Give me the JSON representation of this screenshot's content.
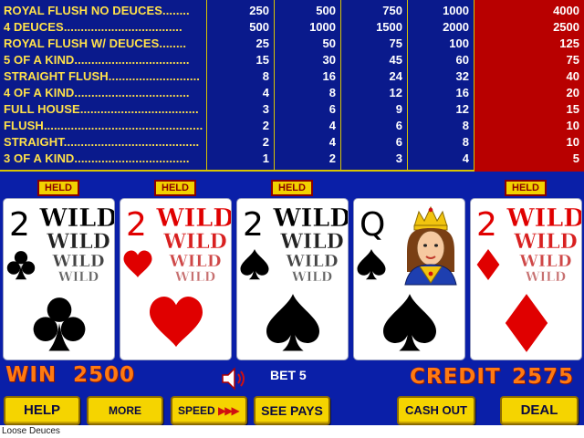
{
  "paytable": {
    "rows": [
      {
        "name": "ROYAL FLUSH NO DEUCES........",
        "pays": [
          "250",
          "500",
          "750",
          "1000",
          "4000"
        ]
      },
      {
        "name": "4 DEUCES...................................",
        "pays": [
          "500",
          "1000",
          "1500",
          "2000",
          "2500"
        ]
      },
      {
        "name": "ROYAL FLUSH W/ DEUCES........",
        "pays": [
          "25",
          "50",
          "75",
          "100",
          "125"
        ]
      },
      {
        "name": "5 OF A KIND..................................",
        "pays": [
          "15",
          "30",
          "45",
          "60",
          "75"
        ]
      },
      {
        "name": "STRAIGHT FLUSH...........................",
        "pays": [
          "8",
          "16",
          "24",
          "32",
          "40"
        ]
      },
      {
        "name": "4 OF A KIND..................................",
        "pays": [
          "4",
          "8",
          "12",
          "16",
          "20"
        ]
      },
      {
        "name": "FULL HOUSE...................................",
        "pays": [
          "3",
          "6",
          "9",
          "12",
          "15"
        ]
      },
      {
        "name": "FLUSH...............................................",
        "pays": [
          "2",
          "4",
          "6",
          "8",
          "10"
        ]
      },
      {
        "name": "STRAIGHT........................................",
        "pays": [
          "2",
          "4",
          "6",
          "8",
          "10"
        ]
      },
      {
        "name": "3 OF A KIND..................................",
        "pays": [
          "1",
          "2",
          "3",
          "4",
          "5"
        ]
      }
    ],
    "highlight_column": 5,
    "colors": {
      "background": "#0a1a8c",
      "highlight": "#b80000",
      "names": "#ffe14a",
      "lines": "#d8c400"
    }
  },
  "hand": {
    "held_label": "HELD",
    "cards": [
      {
        "rank": "2",
        "suit": "clubs",
        "color": "#000000",
        "held": true,
        "wild_text": [
          "WILD",
          "WILD",
          "WILD",
          "WILD"
        ]
      },
      {
        "rank": "2",
        "suit": "hearts",
        "color": "#e00000",
        "held": true,
        "wild_text": [
          "WILD",
          "WILD",
          "WILD",
          "WILD"
        ]
      },
      {
        "rank": "2",
        "suit": "spades",
        "color": "#000000",
        "held": true,
        "wild_text": [
          "WILD",
          "WILD",
          "WILD",
          "WILD"
        ]
      },
      {
        "rank": "Q",
        "suit": "spades",
        "color": "#000000",
        "held": false,
        "face": "queen"
      },
      {
        "rank": "2",
        "suit": "diamonds",
        "color": "#e00000",
        "held": true,
        "wild_text": [
          "WILD",
          "WILD",
          "WILD",
          "WILD"
        ]
      }
    ]
  },
  "status": {
    "win_label": "WIN",
    "win_value": "2500",
    "bet_text": "BET 5",
    "credit_label": "CREDIT",
    "credit_value": "2575",
    "sound_icon": "speaker-on-icon"
  },
  "buttons": {
    "help": "HELP",
    "more_games": "MORE GAMES",
    "speed": "SPEED",
    "see_pays": "SEE PAYS",
    "cash_out": "CASH OUT",
    "deal": "DEAL"
  },
  "footer": {
    "game_name": "Loose Deuces"
  }
}
